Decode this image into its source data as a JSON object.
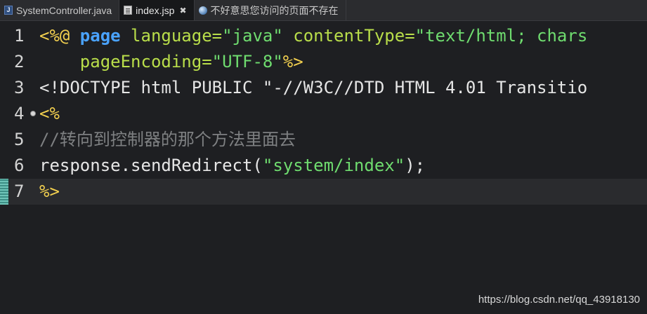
{
  "tabs": [
    {
      "label": "SystemController.java",
      "icon": "java-file-icon",
      "active": false
    },
    {
      "label": "index.jsp",
      "icon": "jsp-file-icon",
      "active": true,
      "close": "✖"
    },
    {
      "label": "不好意思您访问的页面不存在",
      "icon": "web-page-icon",
      "active": false
    }
  ],
  "editor": {
    "current_line": 7,
    "lines": [
      {
        "num": "1",
        "segments": [
          {
            "text": "<%@ ",
            "cls": "delim"
          },
          {
            "text": "page",
            "cls": "dir"
          },
          {
            "text": " language",
            "cls": "attr"
          },
          {
            "text": "=",
            "cls": "attr"
          },
          {
            "text": "\"java\"",
            "cls": "str"
          },
          {
            "text": " contentType",
            "cls": "attr"
          },
          {
            "text": "=",
            "cls": "attr"
          },
          {
            "text": "\"text/html; chars",
            "cls": "str"
          }
        ]
      },
      {
        "num": "2",
        "segments": [
          {
            "text": "    pageEncoding",
            "cls": "attr"
          },
          {
            "text": "=",
            "cls": "attr"
          },
          {
            "text": "\"UTF-8\"",
            "cls": "str"
          },
          {
            "text": "%>",
            "cls": "delim"
          }
        ]
      },
      {
        "num": "3",
        "segments": [
          {
            "text": "<!DOCTYPE html PUBLIC \"-//W3C//DTD HTML 4.01 Transitio",
            "cls": "plain"
          }
        ]
      },
      {
        "num": "4",
        "segments": [
          {
            "text": "<%",
            "cls": "delim"
          }
        ]
      },
      {
        "num": "5",
        "segments": [
          {
            "text": "//转向到控制器的那个方法里面去",
            "cls": "comment"
          }
        ]
      },
      {
        "num": "6",
        "segments": [
          {
            "text": "response.sendRedirect(",
            "cls": "method"
          },
          {
            "text": "\"system/index\"",
            "cls": "str"
          },
          {
            "text": ");",
            "cls": "method"
          }
        ]
      },
      {
        "num": "7",
        "segments": [
          {
            "text": "%>",
            "cls": "delim"
          }
        ]
      }
    ]
  },
  "watermark": "https://blog.csdn.net/qq_43918130",
  "colors": {
    "background": "#1e1f22",
    "delimiter": "#f3d04f",
    "directive": "#4aa3ff",
    "attribute": "#b9de4a",
    "string": "#6fdc6f",
    "comment": "#7e8082"
  }
}
